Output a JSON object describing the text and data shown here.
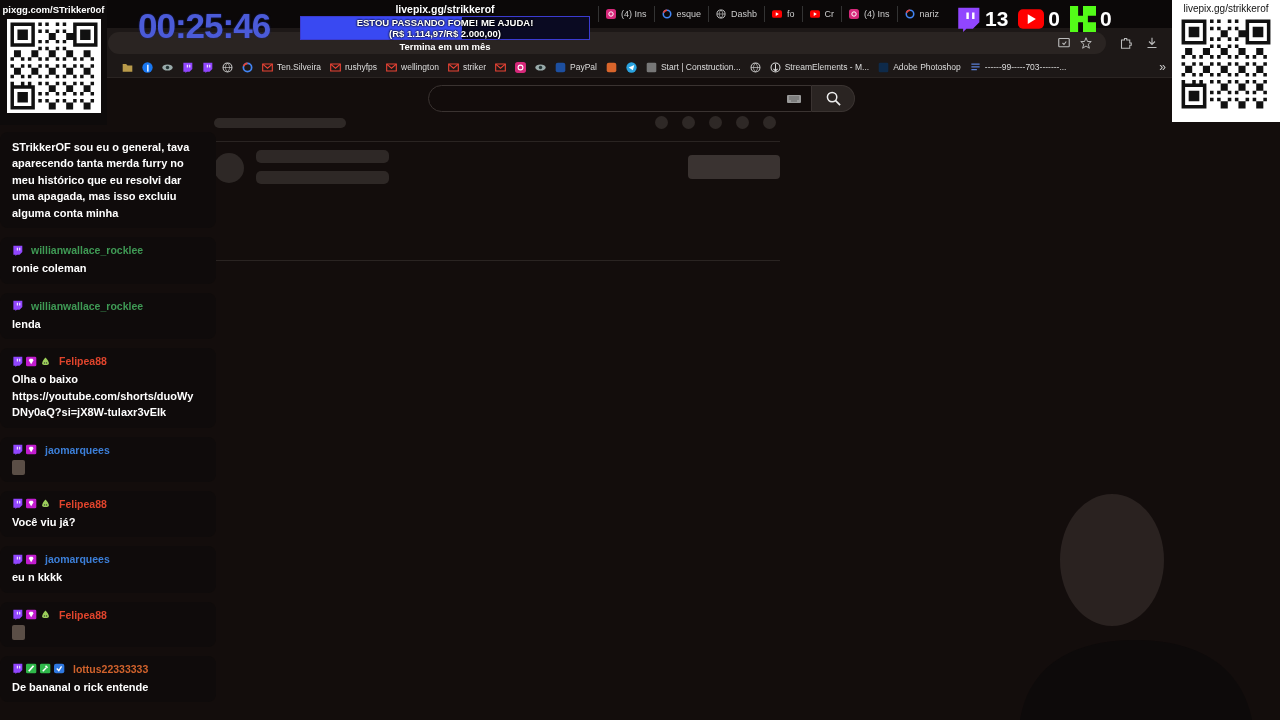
{
  "browser": {
    "tabs": [
      {
        "kind": "instagram",
        "label": "(4) Ins"
      },
      {
        "kind": "google",
        "label": "esque"
      },
      {
        "kind": "web",
        "label": "Dashb"
      },
      {
        "kind": "youtube",
        "label": "fo"
      },
      {
        "kind": "youtube",
        "label": "Cr"
      },
      {
        "kind": "instagram",
        "label": "(4) Ins"
      },
      {
        "kind": "google",
        "label": "nariz"
      }
    ],
    "bookmarks": [
      {
        "kind": "folder"
      },
      {
        "kind": "facebook"
      },
      {
        "kind": "eye"
      },
      {
        "kind": "twitch"
      },
      {
        "kind": "twitch"
      },
      {
        "kind": "web"
      },
      {
        "kind": "google"
      },
      {
        "kind": "gmail",
        "label": "Ten.Silveira"
      },
      {
        "kind": "gmail",
        "label": "rushyfps"
      },
      {
        "kind": "gmail",
        "label": "wellington"
      },
      {
        "kind": "gmail",
        "label": "striker"
      },
      {
        "kind": "gmail"
      },
      {
        "kind": "instagram"
      },
      {
        "kind": "eye"
      },
      {
        "kind": "paypal",
        "label": "PayPal"
      },
      {
        "kind": "app"
      },
      {
        "kind": "telegram"
      },
      {
        "kind": "construction",
        "label": "Start | Construction..."
      },
      {
        "kind": "web"
      },
      {
        "kind": "streamelements",
        "label": "StreamElements - M..."
      },
      {
        "kind": "photoshop",
        "label": "Adobe Photoshop"
      },
      {
        "kind": "doc",
        "label": "------99-----703-------..."
      }
    ],
    "bookmarks_more": "»"
  },
  "overlay": {
    "donation_link": "pixgg.com/STrikker0of",
    "timer": "00:25:46",
    "goal": {
      "link": "livepix.gg/strikkerof",
      "title": "ESTOU PASSANDO FOME! ME AJUDA!",
      "amount": "(R$ 1.114,97/R$ 2.000,00)",
      "level": 0.56,
      "ends": "Termina em um mês"
    },
    "counters": [
      {
        "kind": "twitch",
        "count": "13"
      },
      {
        "kind": "youtube",
        "count": "0"
      },
      {
        "kind": "kick",
        "count": "0"
      }
    ],
    "qr_link": "livepix.gg/strikkerof"
  },
  "chat": [
    {
      "text": "STrikkerOF sou eu o general, tava aparecendo tanta merda furry no meu histórico que eu resolvi dar uma apagada, mas isso excluiu alguma conta minha",
      "kind": "text"
    },
    {
      "badges": [
        {
          "kind": "twitch"
        }
      ],
      "name": "willianwallace_rocklee",
      "color": "#3f9a55",
      "text": "ronie coleman",
      "kind": "text"
    },
    {
      "badges": [
        {
          "kind": "twitch"
        }
      ],
      "name": "willianwallace_rocklee",
      "color": "#3f9a55",
      "text": "lenda",
      "kind": "text"
    },
    {
      "badges": [
        {
          "kind": "twitch"
        },
        {
          "kind": "sub"
        },
        {
          "kind": "pear"
        }
      ],
      "name": "Felipea88",
      "color": "#e0442c",
      "text": "Olha o baixo https://youtube.com/shorts/duoWyDNy0aQ?si=jX8W-tulaxr3vElk",
      "kind": "text"
    },
    {
      "badges": [
        {
          "kind": "twitch"
        },
        {
          "kind": "sub"
        }
      ],
      "name": "jaomarquees",
      "color": "#3c7fd8",
      "kind": "emote"
    },
    {
      "badges": [
        {
          "kind": "twitch"
        },
        {
          "kind": "sub"
        },
        {
          "kind": "pear"
        }
      ],
      "name": "Felipea88",
      "color": "#e0442c",
      "text": "Você viu já?",
      "kind": "text"
    },
    {
      "badges": [
        {
          "kind": "twitch"
        },
        {
          "kind": "sub"
        }
      ],
      "name": "jaomarquees",
      "color": "#3c7fd8",
      "text": "eu n kkkk",
      "kind": "text"
    },
    {
      "badges": [
        {
          "kind": "twitch"
        },
        {
          "kind": "sub"
        },
        {
          "kind": "pear"
        }
      ],
      "name": "Felipea88",
      "color": "#e0442c",
      "kind": "emote"
    },
    {
      "badges": [
        {
          "kind": "twitch"
        },
        {
          "kind": "sword"
        },
        {
          "kind": "wrench"
        },
        {
          "kind": "verified"
        }
      ],
      "name": "lottus22333333",
      "color": "#d0622c",
      "text": "De bananal o rick entende",
      "kind": "text"
    }
  ]
}
